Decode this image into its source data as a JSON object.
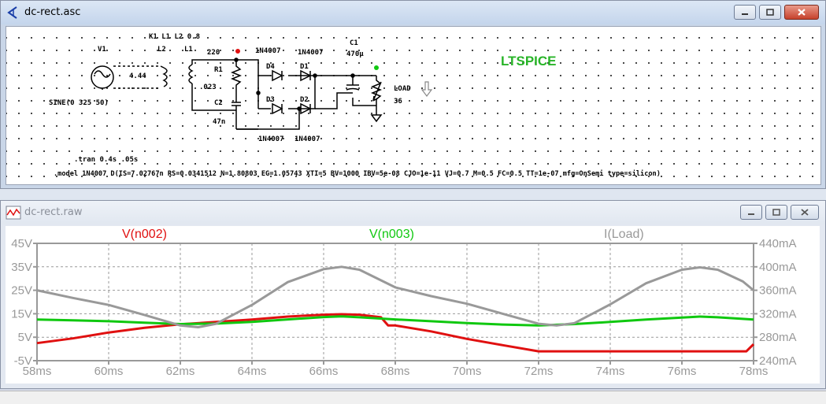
{
  "schematic_window": {
    "title": "dc-rect.asc",
    "labels": {
      "coupling": "K1 L1 L2 0.8",
      "v1": "V1",
      "l2": "L2",
      "l1": "L1",
      "v1_value": "4.44",
      "r1_value": "220",
      "r1": "R1",
      "l1_value": ".023",
      "c2": "C2",
      "c2_value": "47n",
      "d4_model": "1N4007",
      "d1_model": "1N4007",
      "d4": "D4",
      "d1": "D1",
      "d3": "D3",
      "d2": "D2",
      "d3_model": "1N4007",
      "d2_model": "1N4007",
      "c1": "C1",
      "c1_value": "470µ",
      "load": "LOAD",
      "load_value": "36",
      "sine": "SINE(0 325 50)",
      "tran": ".tran 0.4s .05s",
      "model": ".model 1N4007 D(IS=7.02767n RS=0.0341512 N=1.80803 EG=1.05743 XTI=5 BV=1000 IBV=5e-08 CJO=1e-11 VJ=0.7 M=0.5 FC=0.5 TT=1e-07 mfg=OnSemi type=silicon)",
      "ltspice": "LTSPICE"
    }
  },
  "waveform_window": {
    "title": "dc-rect.raw"
  },
  "chart_data": {
    "type": "line",
    "xlabel": "",
    "x_ticks": [
      "58ms",
      "60ms",
      "62ms",
      "64ms",
      "66ms",
      "68ms",
      "70ms",
      "72ms",
      "74ms",
      "76ms",
      "78ms"
    ],
    "xlim": [
      58,
      78
    ],
    "left_ticks": [
      "45V",
      "35V",
      "25V",
      "15V",
      "5V",
      "-5V"
    ],
    "ylim_left": [
      -5,
      45
    ],
    "right_ticks": [
      "440mA",
      "400mA",
      "360mA",
      "320mA",
      "280mA",
      "240mA"
    ],
    "ylim_right": [
      240,
      440
    ],
    "grid": true,
    "series": [
      {
        "name": "V(n002)",
        "color": "#e01010",
        "axis": "left",
        "x": [
          58,
          59,
          60,
          61,
          62,
          63,
          64,
          65,
          66,
          66.5,
          67,
          67.6,
          67.8,
          68,
          69,
          70,
          71,
          72,
          73,
          74,
          75,
          76,
          77,
          77.8,
          78
        ],
        "y": [
          2.5,
          4.5,
          7,
          9,
          10.5,
          11.5,
          12.5,
          13.8,
          14.6,
          14.8,
          14.6,
          13.5,
          10,
          10,
          7.5,
          4.3,
          1.6,
          -1,
          -1,
          -1,
          -1,
          -1,
          -1,
          -1,
          2
        ]
      },
      {
        "name": "V(n003)",
        "color": "#10c810",
        "axis": "left",
        "x": [
          58,
          59,
          60,
          61,
          62,
          63,
          64,
          65,
          66,
          66.5,
          67,
          68,
          69,
          70,
          71,
          72,
          73,
          74,
          75,
          76,
          76.5,
          77,
          78
        ],
        "y": [
          12.5,
          12.2,
          11.8,
          11.2,
          10.6,
          10.8,
          11.5,
          12.6,
          13.6,
          13.9,
          13.5,
          12.6,
          11.8,
          11,
          10.4,
          10,
          10.6,
          11.5,
          12.5,
          13.4,
          13.8,
          13.5,
          12.5
        ]
      },
      {
        "name": "I(Load)",
        "color": "#999999",
        "axis": "right",
        "x": [
          58,
          59,
          60,
          61,
          62,
          62.5,
          63,
          64,
          65,
          66,
          66.5,
          67,
          68,
          69,
          70,
          71,
          72,
          72.5,
          73,
          74,
          75,
          76,
          76.5,
          77,
          77.7,
          78
        ],
        "y": [
          360,
          347,
          335,
          318,
          300,
          297,
          303,
          335,
          374,
          396,
          400,
          395,
          365,
          350,
          337,
          320,
          303,
          300,
          304,
          336,
          372,
          395,
          399,
          395,
          375,
          360
        ]
      }
    ]
  }
}
